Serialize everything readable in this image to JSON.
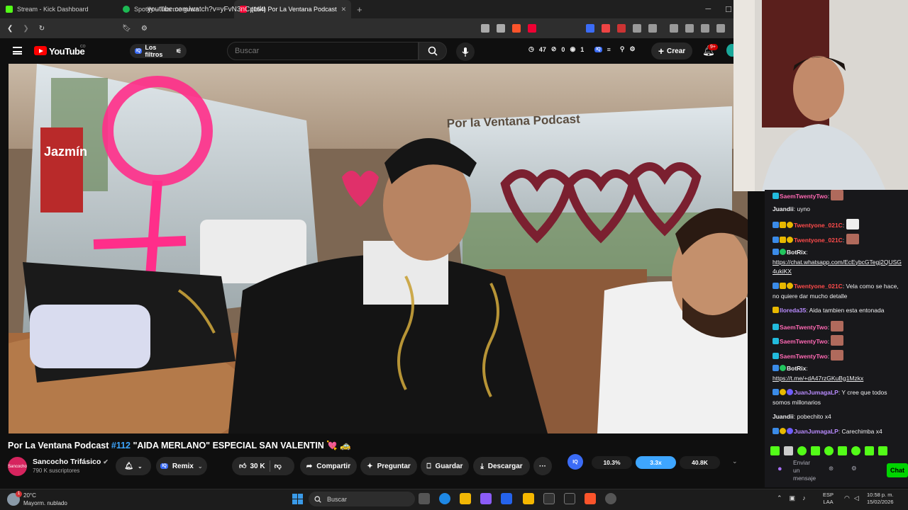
{
  "browser": {
    "tabs": [
      {
        "label": "Stream - Kick Dashboard",
        "color": "#53fc18"
      },
      {
        "label": "Spotify – Tus me gusta",
        "color": "#1db954"
      },
      {
        "label": "(164) Por La Ventana Podcast",
        "color": "#ff0033"
      }
    ],
    "url": "youtube.com/watch?v=yFvN3nCpmkI",
    "extension_badge": "1"
  },
  "youtube": {
    "logo_text": "YouTube",
    "country_code": "CO",
    "filters_label": "Los filtros",
    "iq_label": "IQ",
    "search_placeholder": "Buscar",
    "stat_1": "47",
    "stat_2": "0",
    "stat_3": "1",
    "create_label": "Crear",
    "notifications": "9+"
  },
  "video": {
    "title_prefix": "Por La Ventana Podcast ",
    "title_number": "#112",
    "title_rest": " \"AIDA MERLANO\" ESPECIAL SAN VALENTIN 💘 🚕",
    "overlay_text": "Por la Ventana Podcast",
    "sign_text": "Jazmín"
  },
  "channel": {
    "name": "Sancocho Trifásico",
    "subscribers": "790 K suscriptores",
    "avatar_text": "Sancocho"
  },
  "actions": {
    "remix": "Remix",
    "likes": "30 K",
    "share": "Compartir",
    "ask": "Preguntar",
    "save": "Guardar",
    "download": "Descargar",
    "more": "···"
  },
  "ext_stats": {
    "iq": "IQ",
    "a": "10.3%",
    "b": "3.3x",
    "c": "40.8K"
  },
  "chat": {
    "messages": [
      {
        "user": "SaemTwentyTwo",
        "color": "#ff69b4",
        "text": ":",
        "emote": true
      },
      {
        "user": "Juandii",
        "color": "#ffffff",
        "text": ": uyno"
      },
      {
        "user": "Twentyone_021C",
        "color": "#ff4b4b",
        "text": ":",
        "emote": true
      },
      {
        "user": "Twentyone_021C",
        "color": "#ff4b4b",
        "text": ":",
        "emote": true
      },
      {
        "user": "BotRix",
        "color": "#ffffff",
        "text": ":",
        "link": "https://chat.whatsapp.com/EcEybcGTegj2QUSG4ukiKX"
      },
      {
        "user": "Twentyone_021C",
        "color": "#ff4b4b",
        "text": ": Vela como se hace, no quiere dar mucho detalle"
      },
      {
        "user": "lloreda35",
        "color": "#b98cff",
        "text": ": Aida tambien esta entonada"
      },
      {
        "user": "SaemTwentyTwo",
        "color": "#ff69b4",
        "text": ":",
        "emote": true
      },
      {
        "user": "SaemTwentyTwo",
        "color": "#ff69b4",
        "text": ":",
        "emote": true
      },
      {
        "user": "SaemTwentyTwo",
        "color": "#ff69b4",
        "text": ":",
        "emote": true
      },
      {
        "user": "BotRix",
        "color": "#ffffff",
        "text": ":",
        "link": "https://t.me/+dA47rzGKuBg1Mzkx"
      },
      {
        "user": "JuanJumagaLP",
        "color": "#b98cff",
        "text": ": Y cree que todos somos millonarios"
      },
      {
        "user": "Juandii",
        "color": "#ffffff",
        "text": ": pobechito x4"
      },
      {
        "user": "JuanJumagaLP",
        "color": "#b98cff",
        "text": ": Carechimba x4"
      }
    ],
    "input_placeholder": "Enviar un mensaje",
    "send_label": "Chat"
  },
  "taskbar": {
    "temp": "20°C",
    "weather": "Mayorm. nublado",
    "alert": "1",
    "search": "Buscar",
    "lang": "ESP",
    "lang2": "LAA",
    "time": "10:58 p. m.",
    "date": "15/02/2026"
  }
}
